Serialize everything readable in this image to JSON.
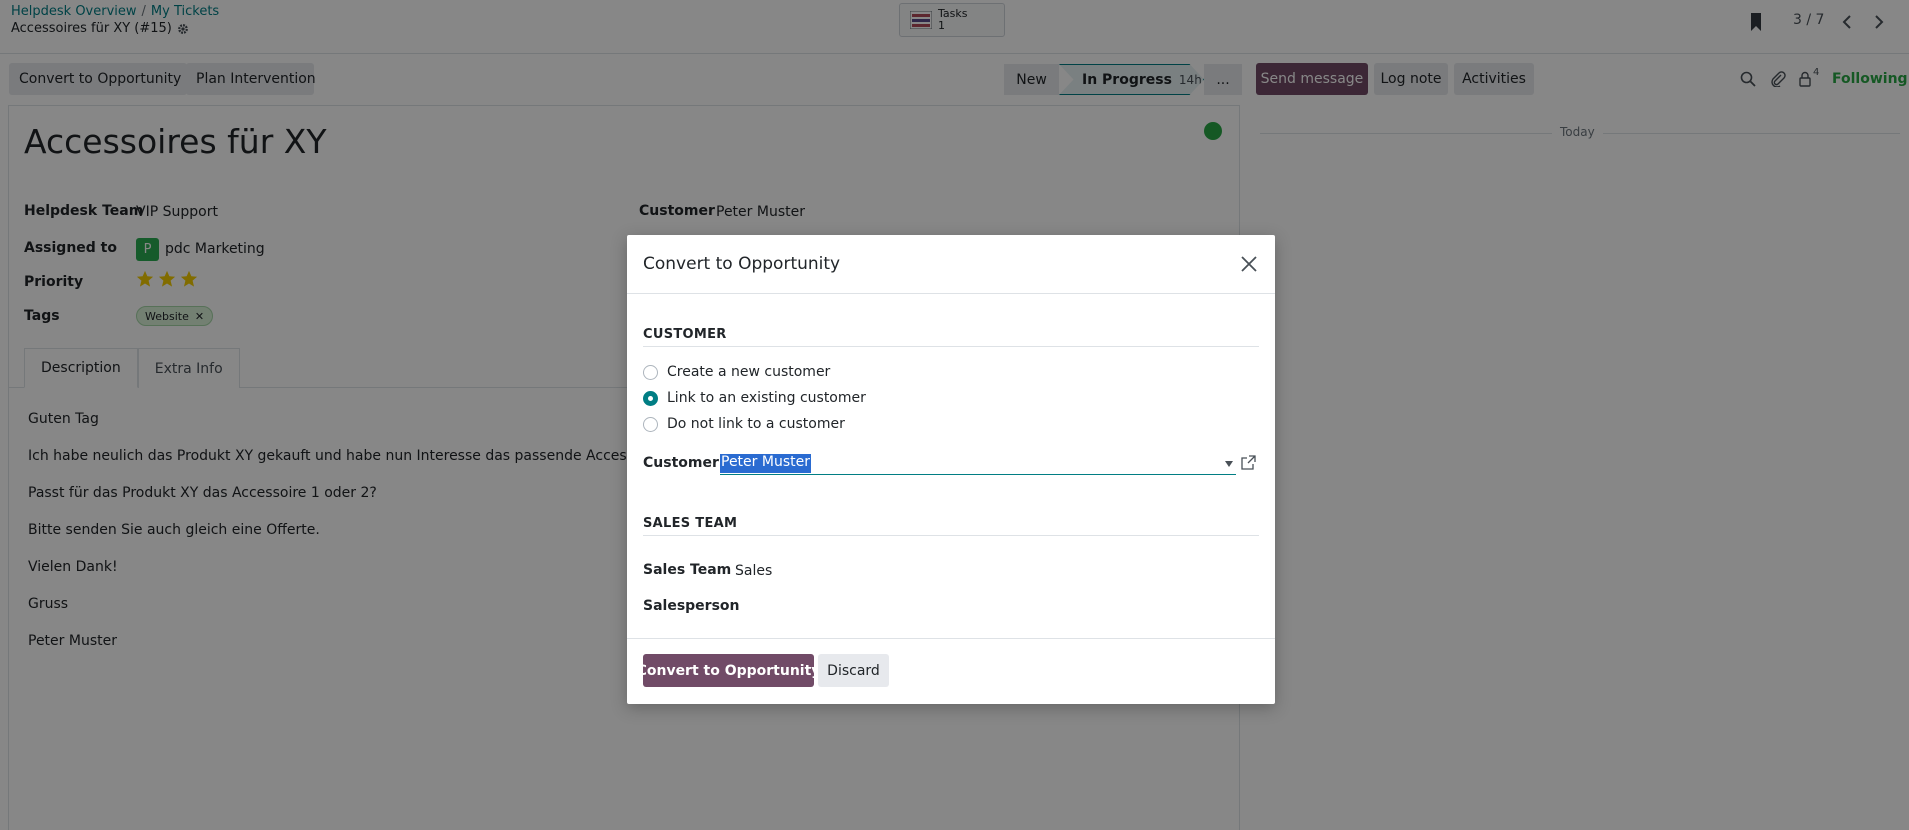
{
  "breadcrumb": {
    "first": "Helpdesk Overview",
    "separator": "/",
    "second": "My Tickets"
  },
  "record": {
    "title": "Accessoires für XY (#15)"
  },
  "tasks_button": {
    "label": "Tasks",
    "count": "1"
  },
  "pager": {
    "value": "3 / 7"
  },
  "actions": {
    "convert": "Convert to Opportunity",
    "plan": "Plan Intervention"
  },
  "stages": {
    "new": "New",
    "in_progress": "In Progress",
    "duration": "14h",
    "more": "..."
  },
  "chatter": {
    "send_message": "Send message",
    "log_note": "Log note",
    "activities": "Activities",
    "follower_count": "4",
    "following": "Following",
    "today": "Today"
  },
  "ticket": {
    "name": "Accessoires für XY",
    "fields": {
      "team_label": "Helpdesk Team",
      "team_value": "VIP Support",
      "assigned_label": "Assigned to",
      "assigned_initial": "P",
      "assigned_value": "pdc Marketing",
      "priority_label": "Priority",
      "priority_stars": 3,
      "tags_label": "Tags",
      "tag": "Website",
      "tag_remove": "✕",
      "customer_label": "Customer",
      "customer_value": "Peter Muster"
    },
    "tabs": {
      "description": "Description",
      "extra_info": "Extra Info"
    },
    "description": [
      "Guten Tag",
      "Ich habe neulich das Produkt XY gekauft und habe nun Interesse das passende Accessoire zu kau",
      "Passt für das Produkt XY das Accessoire 1 oder 2?",
      "Bitte senden Sie auch gleich eine Offerte.",
      "Vielen Dank!",
      "Gruss",
      "Peter Muster"
    ]
  },
  "modal": {
    "title": "Convert to Opportunity",
    "customer_section": "CUSTOMER",
    "options": {
      "new": "Create a new customer",
      "existing": "Link to an existing customer",
      "none": "Do not link to a customer"
    },
    "customer_label": "Customer",
    "customer_value": "Peter Muster",
    "sales_section": "SALES TEAM",
    "sales_team_label": "Sales Team",
    "sales_team_value": "Sales",
    "salesperson_label": "Salesperson",
    "confirm": "Convert to Opportunity",
    "discard": "Discard"
  },
  "colors": {
    "primary": "#714b67",
    "accent": "#017e84",
    "success": "#28a745"
  }
}
